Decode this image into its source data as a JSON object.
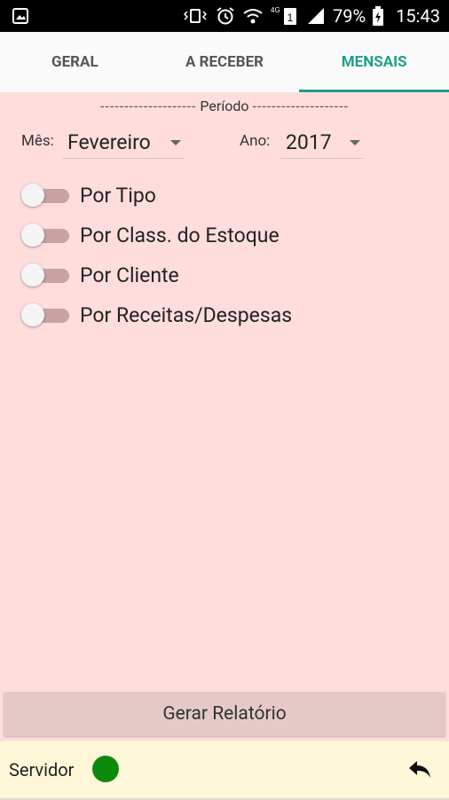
{
  "status_bar": {
    "battery": "79%",
    "time": "15:43",
    "network_label": "4G",
    "sim": "1"
  },
  "tabs": [
    {
      "label": "GERAL",
      "active": false
    },
    {
      "label": "A RECEBER",
      "active": false
    },
    {
      "label": "MENSAIS",
      "active": true
    }
  ],
  "periodo": {
    "title": "Período",
    "month_label": "Mês:",
    "month_value": "Fevereiro",
    "year_label": "Ano:",
    "year_value": "2017"
  },
  "toggles": [
    {
      "label": "Por Tipo",
      "on": false
    },
    {
      "label": "Por Class. do Estoque",
      "on": false
    },
    {
      "label": "Por Cliente",
      "on": false
    },
    {
      "label": "Por Receitas/Despesas",
      "on": false
    }
  ],
  "actions": {
    "generate_label": "Gerar Relatório"
  },
  "footer": {
    "server_label": "Servidor",
    "server_status_color": "#0c8a0c"
  },
  "colors": {
    "accent": "#1f9e8a",
    "background": "#ffdddd"
  }
}
